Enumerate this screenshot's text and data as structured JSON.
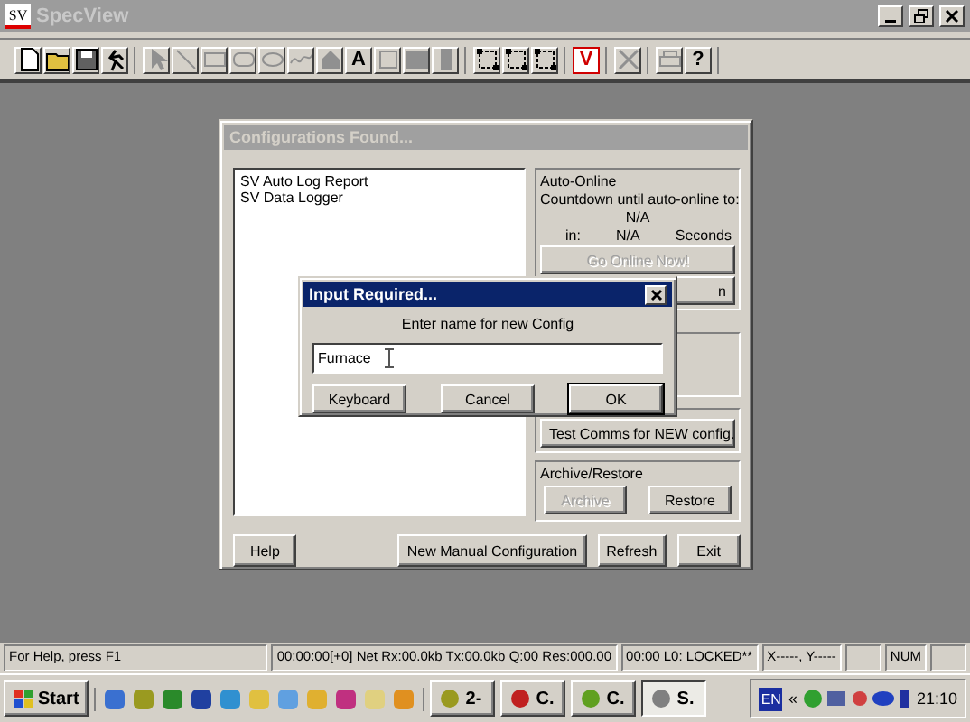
{
  "window": {
    "logo": "SV",
    "title": "SpecView",
    "active": false
  },
  "toolbar_groups": [
    [
      {
        "disabled": false
      },
      {
        "disabled": false
      },
      {
        "disabled": false
      },
      {
        "disabled": false
      }
    ],
    [
      {
        "disabled": true
      },
      {
        "disabled": true
      },
      {
        "disabled": true
      },
      {
        "disabled": true
      },
      {
        "disabled": true
      },
      {
        "disabled": true
      },
      {
        "disabled": true
      },
      {
        "disabled": false,
        "glyph": "A"
      },
      {
        "disabled": true
      },
      {
        "disabled": true
      },
      {
        "disabled": true
      }
    ],
    [
      {
        "disabled": false
      },
      {
        "disabled": false
      },
      {
        "disabled": false
      }
    ],
    [
      {
        "disabled": false,
        "glyph": "V"
      }
    ],
    [
      {
        "disabled": true
      }
    ],
    [
      {
        "disabled": true
      },
      {
        "disabled": false,
        "glyph": "?"
      }
    ]
  ],
  "configurations_dialog": {
    "title": "Configurations Found...",
    "active": false,
    "list": [
      {
        "label": "SV Auto Log Report",
        "selected": false
      },
      {
        "label": "SV Data Logger",
        "selected": false
      }
    ],
    "auto_online": {
      "title": "Auto-Online",
      "countdown_label": "Countdown until auto-online to:",
      "target": "N/A",
      "in_label": "in:",
      "seconds_value": "N/A",
      "seconds_label": "Seconds"
    },
    "go_online_button": {
      "label": "Go Online Now!",
      "disabled": true
    },
    "hidden_button": {
      "label": "n"
    },
    "test_comms_button": {
      "label": "Test Comms for NEW config."
    },
    "archive_restore": {
      "title": "Archive/Restore",
      "buttons": [
        {
          "label": "Archive",
          "disabled": true
        },
        {
          "label": "Restore",
          "disabled": false
        }
      ]
    },
    "bottom_buttons": [
      {
        "label": "Help"
      },
      {
        "label": "New Manual Configuration"
      },
      {
        "label": "Refresh"
      },
      {
        "label": "Exit"
      }
    ]
  },
  "input_dialog": {
    "title": "Input Required...",
    "prompt": "Enter name for new Config",
    "value": "Furnace",
    "buttons": [
      {
        "label": "Keyboard",
        "default": false
      },
      {
        "label": "Cancel",
        "default": false
      },
      {
        "label": "OK",
        "default": true
      }
    ]
  },
  "status_bar": [
    "For Help, press F1",
    "00:00:00[+0] Net Rx:00.0kb Tx:00.0kb Q:00 Res:000.00",
    "00:00 L0: LOCKED**",
    "X-----, Y-----",
    "NUM"
  ],
  "taskbar": {
    "start": "Start",
    "tasks": [
      {
        "label": "2-",
        "selected": false
      },
      {
        "label": "C.",
        "selected": false
      },
      {
        "label": "C.",
        "selected": false
      },
      {
        "label": "S.",
        "selected": true
      }
    ],
    "language": "EN",
    "chevron": "«",
    "time": "21:10"
  }
}
